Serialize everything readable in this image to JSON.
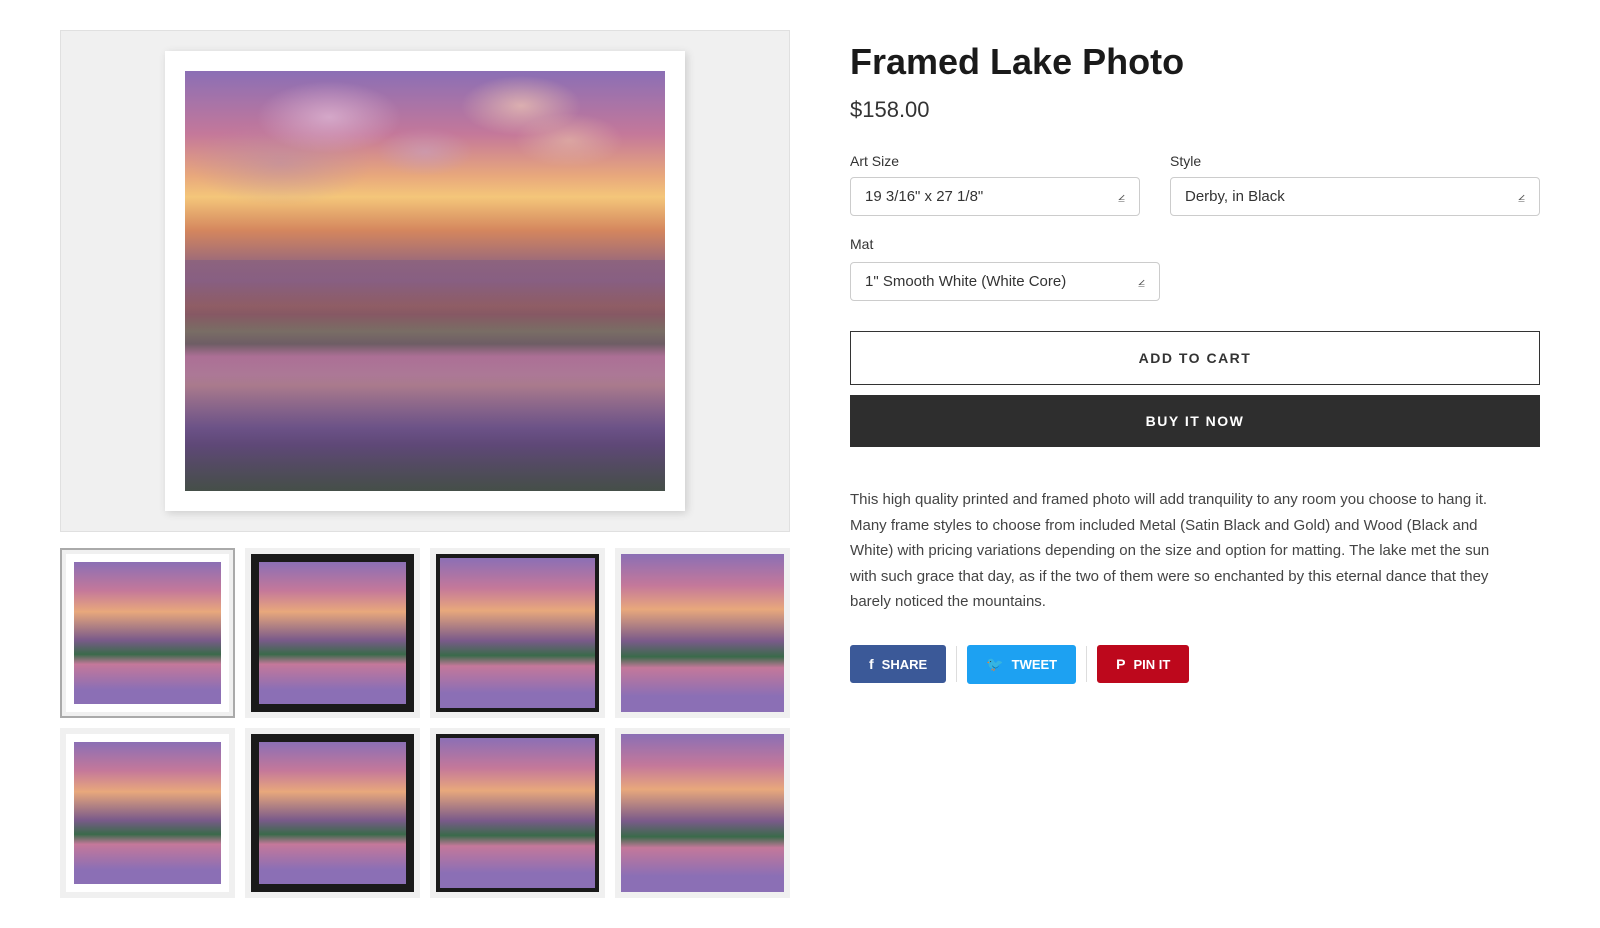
{
  "product": {
    "title": "Framed Lake Photo",
    "price": "$158.00",
    "description": "This high quality printed and framed photo will add tranquility to any room you choose to hang it. Many frame styles to choose from included Metal (Satin Black and Gold) and Wood (Black and White) with pricing variations depending on the size and option for matting. The lake met the sun with such grace that day, as if the two of them were so enchanted by this eternal dance that they barely noticed the mountains."
  },
  "options": {
    "art_size_label": "Art Size",
    "art_size_value": "19 3/16\" x 27 1/8\"",
    "style_label": "Style",
    "style_value": "Derby, in Black",
    "mat_label": "Mat",
    "mat_value": "1\" Smooth White (White Core)"
  },
  "buttons": {
    "add_to_cart": "ADD TO CART",
    "buy_it_now": "BUY IT NOW"
  },
  "social": {
    "share_label": "SHARE",
    "tweet_label": "TWEET",
    "pin_label": "PIN IT"
  },
  "thumbnails": [
    {
      "id": 1,
      "frame": "white",
      "active": true
    },
    {
      "id": 2,
      "frame": "black",
      "active": false
    },
    {
      "id": 3,
      "frame": "black-thin",
      "active": false
    },
    {
      "id": 4,
      "frame": "none",
      "active": false
    },
    {
      "id": 5,
      "frame": "white",
      "active": false
    },
    {
      "id": 6,
      "frame": "black",
      "active": false
    },
    {
      "id": 7,
      "frame": "black-thin",
      "active": false
    },
    {
      "id": 8,
      "frame": "none",
      "active": false
    }
  ]
}
